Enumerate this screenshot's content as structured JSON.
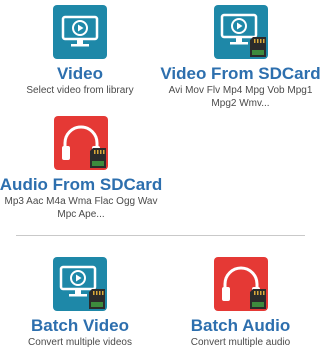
{
  "tiles": {
    "video": {
      "title": "Video",
      "subtitle": "Select video from library"
    },
    "video_sdcard": {
      "title": "Video From SDCard",
      "subtitle_line1": "Avi Mov Flv Mp4 Mpg Vob Mpg1",
      "subtitle_line2": "Mpg2 Wmv..."
    },
    "audio_sdcard": {
      "title": "Audio From SDCard",
      "subtitle_line1": "Mp3 Aac M4a Wma Flac Ogg Wav",
      "subtitle_line2": "Mpc Ape..."
    },
    "batch_video": {
      "title": "Batch Video",
      "subtitle": "Convert multiple videos"
    },
    "batch_audio": {
      "title": "Batch Audio",
      "subtitle": "Convert multiple audio"
    }
  },
  "colors": {
    "video_icon_bg": "#1e88a8",
    "audio_icon_bg": "#e53935",
    "title_text": "#2d6fae",
    "subtitle_text": "#4a4a4a"
  },
  "icons": {
    "video": "monitor-play-icon",
    "video_sdcard": "monitor-sdcard-icon",
    "audio_sdcard": "headphones-sdcard-icon",
    "batch_video": "monitor-sdcard-icon",
    "batch_audio": "headphones-sdcard-icon"
  }
}
